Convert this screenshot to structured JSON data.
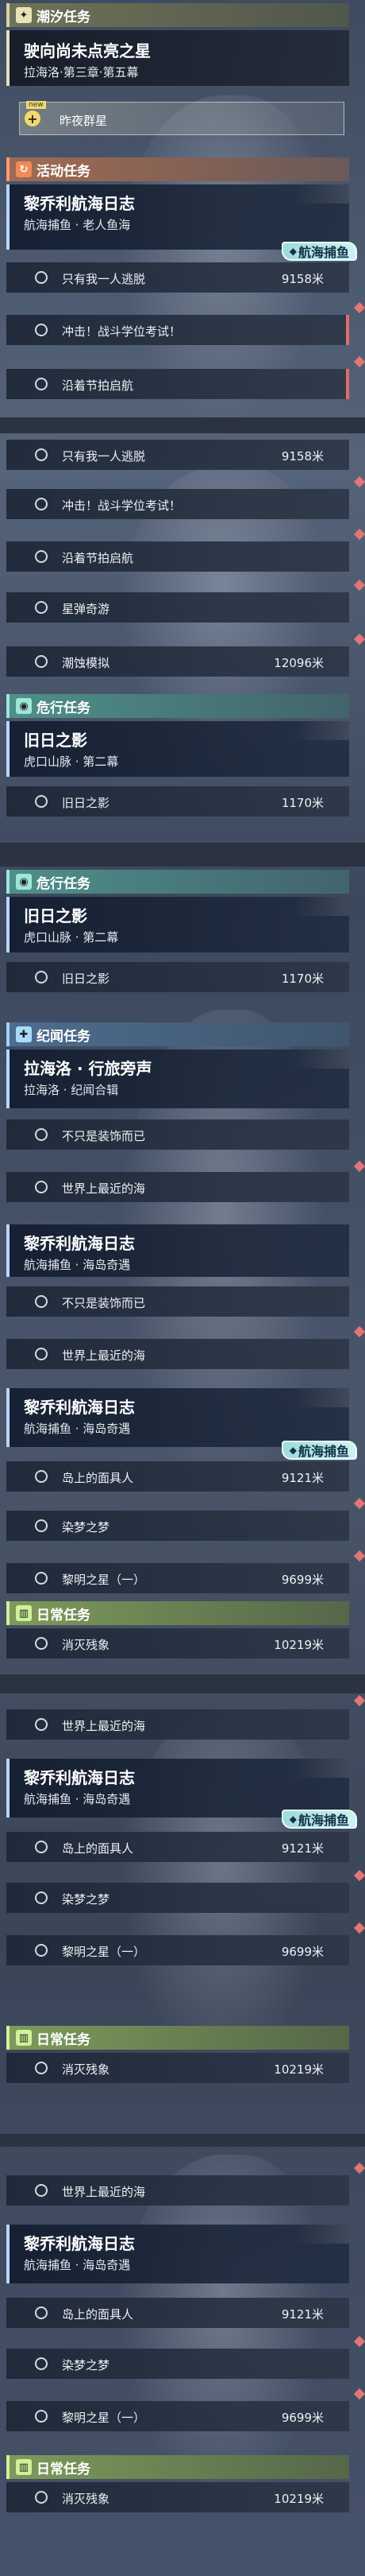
{
  "sections": {
    "tide": "潮汐任务",
    "activity": "活动任务",
    "danger": "危行任务",
    "epic": "纪闻任务",
    "daily": "日常任务"
  },
  "tide_quest": {
    "title": "驶向尚未点亮之星",
    "subtitle": "拉海洛·第三章·第五幕",
    "event_label": "昨夜群星",
    "event_tag": "new"
  },
  "activity_quest": {
    "title": "黎乔利航海日志",
    "subtitle": "航海捕鱼 · 老人鱼海",
    "badge": "航海捕鱼"
  },
  "tasks": {
    "only_me_escape": "只有我一人逃脱",
    "charge": "冲击！战斗学位考试！",
    "rhythm_sail": "沿着节拍启航",
    "starfall": "星弹奇游",
    "tide_sim": "潮蚀模拟",
    "eclipse_shadow": "旧日之影",
    "not_only_decor": "不只是装饰而已",
    "nearest_sea": "世界上最近的海",
    "island_mask": "岛上的面具人",
    "dye_dream": "染梦之梦",
    "dawn_star": "黎明之星（一）",
    "annihilate": "消灭残象"
  },
  "distances": {
    "d9158": "9158米",
    "d12096": "12096米",
    "d1170": "1170米",
    "d9121": "9121米",
    "d9699": "9699米",
    "d10219": "10219米"
  },
  "danger_quest": {
    "title": "旧日之影",
    "subtitle": "虎口山脉 · 第二幕"
  },
  "epic_quest": {
    "title": "拉海洛 · 行旅旁声",
    "subtitle": "拉海洛 · 纪闻合辑"
  },
  "log_quest": {
    "title": "黎乔利航海日志",
    "subtitle": "航海捕鱼 · 海岛奇遇",
    "subtitle_cut": "航海捕鱼 · 海岛奇遇",
    "badge": "航海捕鱼"
  },
  "colors": {
    "tide": "#d6d3a4",
    "activity": "#ff9c6e",
    "danger": "#9ee6d8",
    "epic": "#9fd3ff",
    "daily": "#d0f09a",
    "progress": "#e36a6a"
  }
}
